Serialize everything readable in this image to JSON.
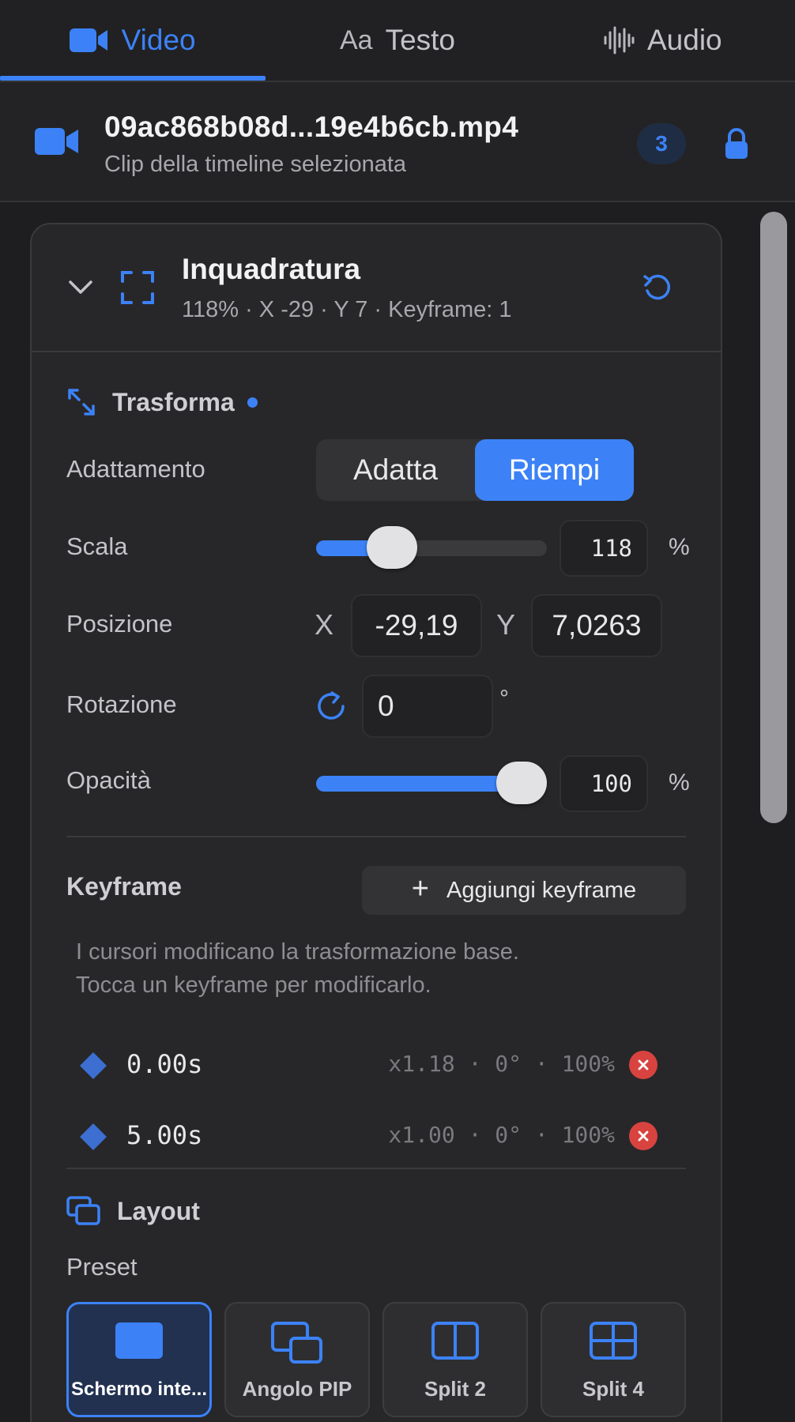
{
  "tabs": [
    {
      "label": "Video",
      "icon": "video-camera-icon",
      "active": true
    },
    {
      "label": "Testo",
      "prefix": "Aa",
      "icon": "text-icon",
      "active": false
    },
    {
      "label": "Audio",
      "icon": "waveform-icon",
      "active": false
    }
  ],
  "clip": {
    "filename": "09ac868b08d...19e4b6cb.mp4",
    "subtitle": "Clip della timeline selezionata",
    "badge_count": "3",
    "lock_icon": "lock-icon"
  },
  "framing": {
    "title": "Inquadratura",
    "summary": "118% · X -29 · Y 7 · Keyframe: 1",
    "expanded": true
  },
  "transform": {
    "title": "Trasforma",
    "fit_label": "Adattamento",
    "fit_options": [
      "Adatta",
      "Riempi"
    ],
    "fit_selected": "Riempi",
    "scale_label": "Scala",
    "scale_value": "118",
    "scale_fraction": 0.33,
    "scale_unit": "%",
    "position_label": "Posizione",
    "x_label": "X",
    "x_value": "-29,19",
    "y_label": "Y",
    "y_value": "7,0263",
    "rotation_label": "Rotazione",
    "rotation_value": "0",
    "rotation_unit": "°",
    "opacity_label": "Opacità",
    "opacity_value": "100",
    "opacity_fraction": 1.0,
    "opacity_unit": "%"
  },
  "keyframes": {
    "title": "Keyframe",
    "add_label": "Aggiungi keyframe",
    "hint_line1": "I cursori modificano la trasformazione base.",
    "hint_line2": "Tocca un keyframe per modificarlo.",
    "items": [
      {
        "time": "0.00s",
        "values": "x1.18 · 0° · 100%"
      },
      {
        "time": "5.00s",
        "values": "x1.00 · 0° · 100%"
      }
    ]
  },
  "layout": {
    "title": "Layout",
    "preset_label": "Preset",
    "presets": [
      {
        "label": "Schermo inte...",
        "icon": "fullscreen-rect-icon",
        "selected": true
      },
      {
        "label": "Angolo PIP",
        "icon": "pip-icon",
        "selected": false
      },
      {
        "label": "Split 2",
        "icon": "split-2-icon",
        "selected": false
      },
      {
        "label": "Split 4",
        "icon": "split-4-icon",
        "selected": false
      }
    ]
  },
  "colors": {
    "accent": "#3c82f6",
    "background": "#1e1e20",
    "panel": "#272729",
    "delete": "#d9433f"
  }
}
